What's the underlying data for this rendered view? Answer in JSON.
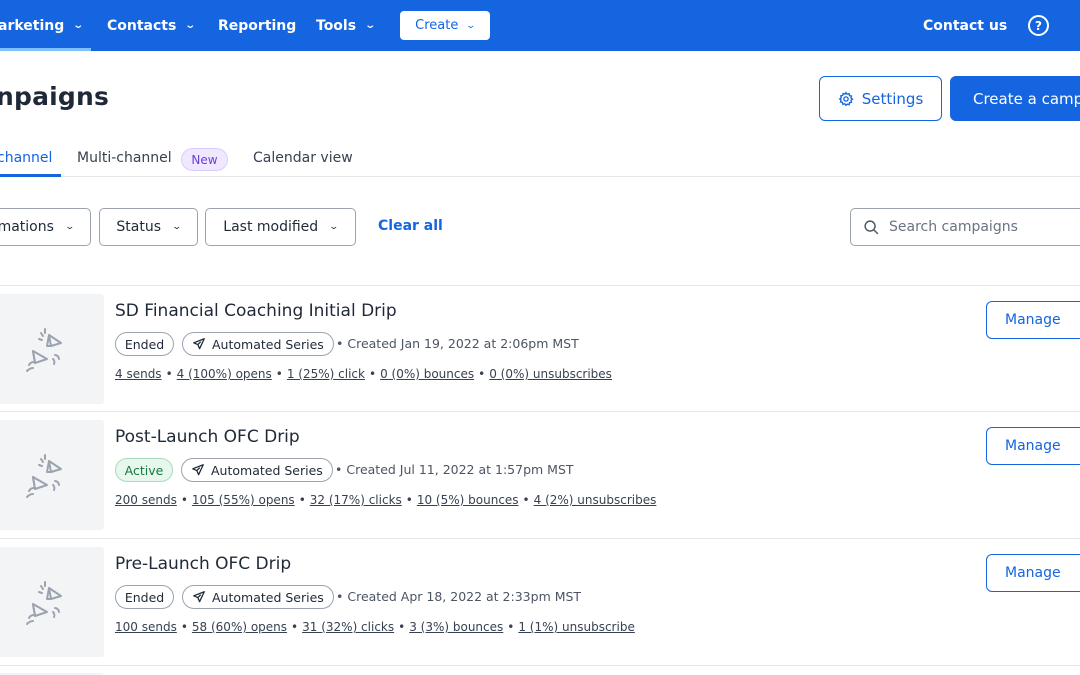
{
  "nav": {
    "items": [
      {
        "label": "arketing",
        "has_dropdown": true
      },
      {
        "label": "Contacts",
        "has_dropdown": true
      },
      {
        "label": "Reporting",
        "has_dropdown": false
      },
      {
        "label": "Tools",
        "has_dropdown": true
      }
    ],
    "create_label": "Create",
    "contact_us_label": "Contact us",
    "help_icon": "?"
  },
  "header": {
    "title": "npaigns",
    "settings_label": "Settings",
    "create_campaign_label": "Create a campa"
  },
  "tabs": [
    {
      "label": "channel",
      "active": true
    },
    {
      "label": "Multi-channel",
      "active": false
    },
    {
      "label": "Calendar view",
      "active": false
    }
  ],
  "new_badge": "New",
  "filters": {
    "items": [
      {
        "label": "mations"
      },
      {
        "label": "Status"
      },
      {
        "label": "Last modified"
      }
    ],
    "clear_all_label": "Clear all",
    "search_placeholder": "Search campaigns",
    "search_value": ""
  },
  "campaigns": [
    {
      "title": "SD Financial Coaching Initial Drip",
      "status": "Ended",
      "type": "Automated Series",
      "created": "• Created Jan 19, 2022 at 2:06pm MST",
      "stats": [
        "4 sends",
        "4 (100%) opens",
        "1 (25%) click",
        "0 (0%) bounces",
        "0 (0%) unsubscribes"
      ],
      "manage_label": "Manage"
    },
    {
      "title": "Post-Launch OFC Drip",
      "status": "Active",
      "type": "Automated Series",
      "created": "• Created Jul 11, 2022 at 1:57pm MST",
      "stats": [
        "200 sends",
        "105 (55%) opens",
        "32 (17%) clicks",
        "10 (5%) bounces",
        "4 (2%) unsubscribes"
      ],
      "manage_label": "Manage"
    },
    {
      "title": "Pre-Launch OFC Drip",
      "status": "Ended",
      "type": "Automated Series",
      "created": "• Created Apr 18, 2022 at 2:33pm MST",
      "stats": [
        "100 sends",
        "58 (60%) opens",
        "31 (32%) clicks",
        "3 (3%) bounces",
        "1 (1%) unsubscribe"
      ],
      "manage_label": "Manage"
    }
  ],
  "colors": {
    "brand_blue": "#1565e0",
    "active_green": "#137a3c",
    "new_purple": "#6b3fd6"
  }
}
